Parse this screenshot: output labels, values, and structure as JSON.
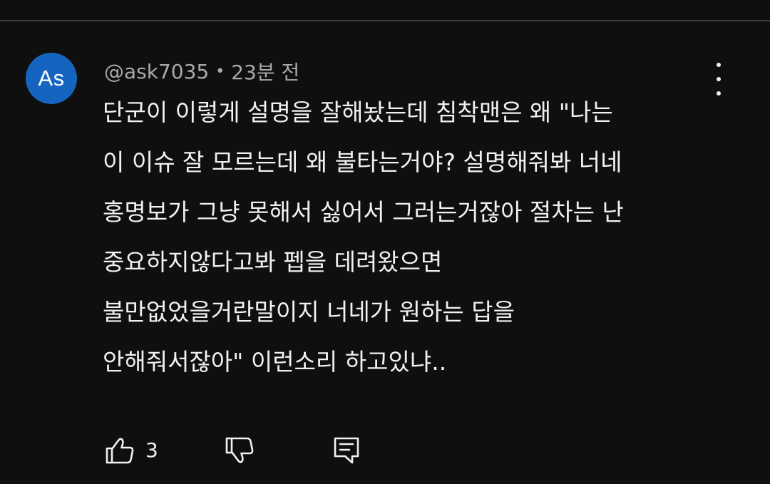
{
  "comment": {
    "avatar_initials": "As",
    "avatar_color": "#1565c0",
    "author": "@ask7035",
    "separator": "•",
    "time": "23분 전",
    "lines": [
      "단군이 이렇게 설명을 잘해놨는데 침착맨은 왜 \"나는",
      "이 이슈 잘 모르는데 왜 불타는거야? 설명해줘봐 너네",
      "홍명보가 그냥 못해서 싫어서 그러는거잖아 절차는 난",
      "중요하지않다고봐 펩을 데려왔으면",
      "불만없었을거란말이지 너네가 원하는 답을",
      "안해줘서잖아\" 이런소리 하고있냐.."
    ],
    "like_count": "3"
  },
  "icons": {
    "more": "more-vert-icon",
    "like": "thumbs-up-icon",
    "dislike": "thumbs-down-icon",
    "reply": "reply-comment-icon"
  },
  "colors": {
    "background": "#0f0f0f",
    "text_primary": "#f1f1f1",
    "text_secondary": "#aaaaaa"
  }
}
